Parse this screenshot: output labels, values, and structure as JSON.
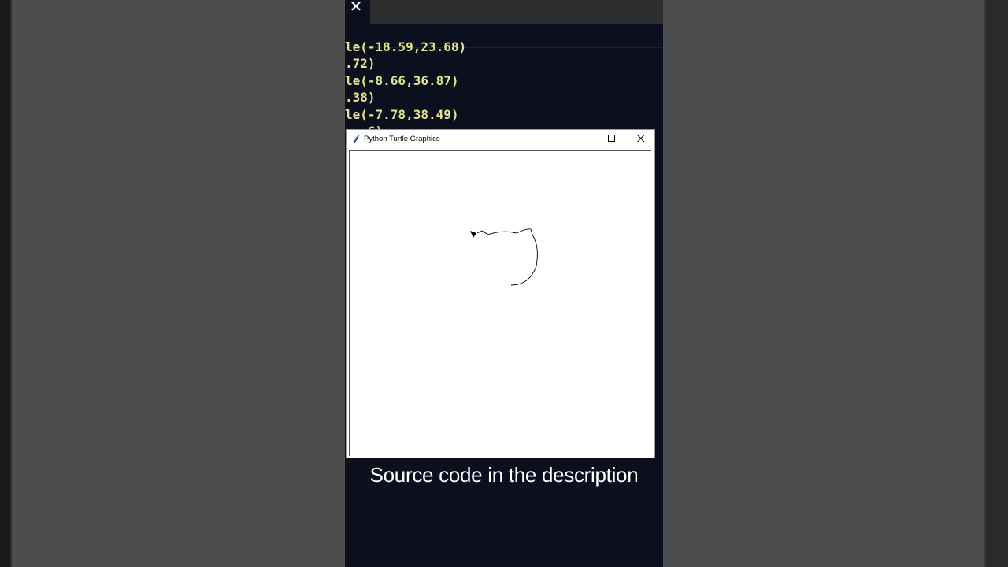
{
  "code_lines": [
    "le(-18.59,23.68)",
    ".72)",
    "le(-8.66,36.87)",
    ".38)",
    "le(-7.78,38.49)",
    "  .6)"
  ],
  "turtle_window": {
    "title": "Python Turtle Graphics",
    "controls": {
      "minimize": "minimize-icon",
      "maximize": "maximize-icon",
      "close": "close-icon"
    }
  },
  "caption": "Source code in the description",
  "colors": {
    "code_text": "#e3e48c",
    "panel_bg": "#0c0f1e",
    "background": "#4d4d4d"
  }
}
